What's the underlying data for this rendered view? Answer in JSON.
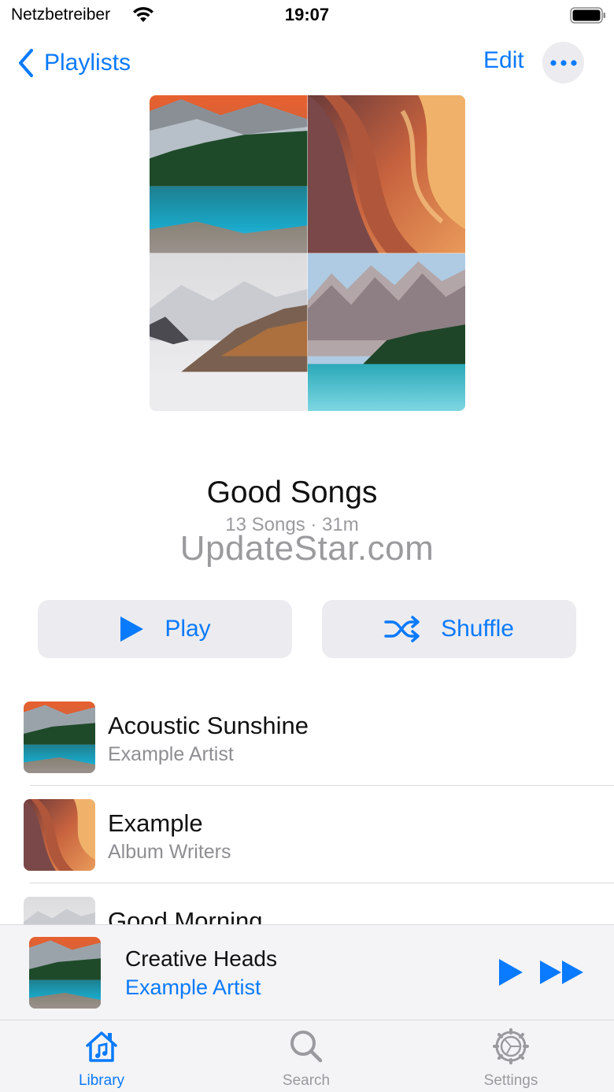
{
  "status_bar": {
    "carrier": "Netzbetreiber",
    "time": "19:07"
  },
  "nav": {
    "back_label": "Playlists",
    "edit_label": "Edit",
    "more_icon": "ellipsis-icon"
  },
  "playlist": {
    "title": "Good Songs",
    "meta": "13 Songs · 31m"
  },
  "watermark": "UpdateStar.com",
  "actions": {
    "play_label": "Play",
    "shuffle_label": "Shuffle"
  },
  "songs": [
    {
      "title": "Acoustic Sunshine",
      "artist": "Example Artist",
      "art": "lake-forest"
    },
    {
      "title": "Example",
      "artist": "Album Writers",
      "art": "canyon"
    },
    {
      "title": "Good Morning",
      "artist": "",
      "art": "misty-mountains"
    }
  ],
  "now_playing": {
    "title": "Creative Heads",
    "artist": "Example Artist"
  },
  "tabs": [
    {
      "label": "Library",
      "icon": "library-icon",
      "selected": true
    },
    {
      "label": "Search",
      "icon": "search-icon",
      "selected": false
    },
    {
      "label": "Settings",
      "icon": "gear-icon",
      "selected": false
    }
  ],
  "colors": {
    "accent": "#0a7aff",
    "secondary_text": "#8e8e93",
    "button_background": "#ececf0"
  }
}
